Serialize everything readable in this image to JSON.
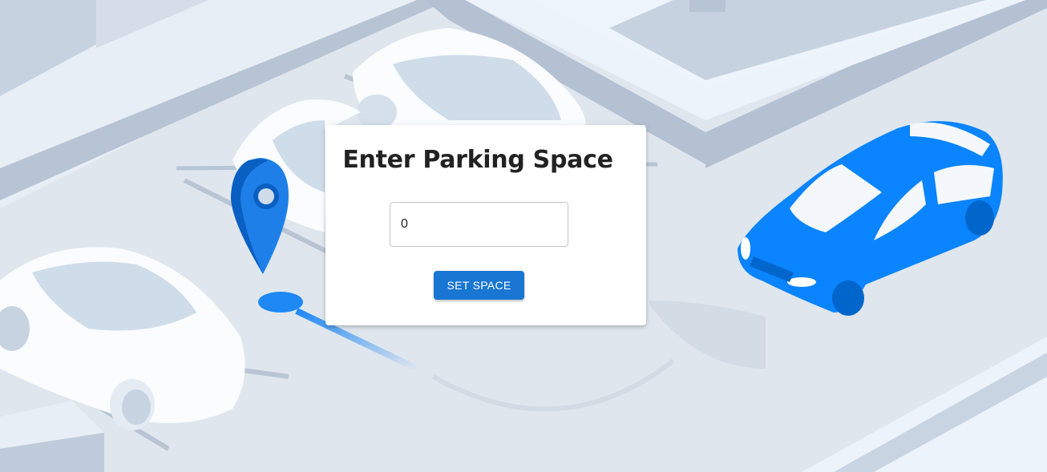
{
  "form": {
    "title": "Enter Parking Space",
    "space_value": "0",
    "submit_label": "SET SPACE"
  },
  "colors": {
    "accent": "#1976d2",
    "car_blue": "#0a84ff",
    "background": "#dde4ec"
  },
  "icons": [
    "location-pin-icon"
  ]
}
